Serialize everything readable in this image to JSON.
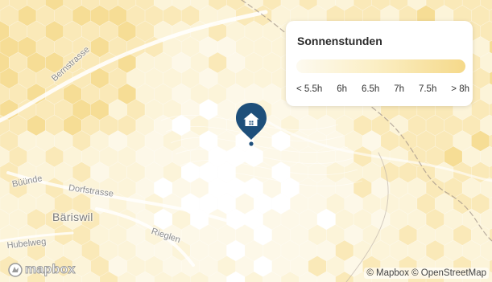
{
  "map": {
    "places": [
      {
        "key": "bernstrasse",
        "label": "Bernstrasse"
      },
      {
        "key": "dorfstrasse",
        "label": "Dorfstrasse"
      },
      {
        "key": "buunde",
        "label": "Büünde"
      },
      {
        "key": "bariswil",
        "label": "Bäriswil"
      },
      {
        "key": "rieglen",
        "label": "Rieglen"
      },
      {
        "key": "hubelweg",
        "label": "Hubelweg"
      }
    ],
    "marker_icon": "home-icon",
    "attribution": "© Mapbox © OpenStreetMap",
    "logo": "mapbox"
  },
  "legend": {
    "title": "Sonnenstunden",
    "ticks": [
      "< 5.5h",
      "6h",
      "6.5h",
      "7h",
      "7.5h",
      "> 8h"
    ],
    "gradient_colors": [
      "#fdfaf0",
      "#fbefc6",
      "#f5d98a"
    ]
  },
  "colors": {
    "marker": "#1e4f7a",
    "hex_dark": "#f6dd95",
    "hex_mid": "#fae9b8",
    "hex_light": "#fcf4d9"
  }
}
